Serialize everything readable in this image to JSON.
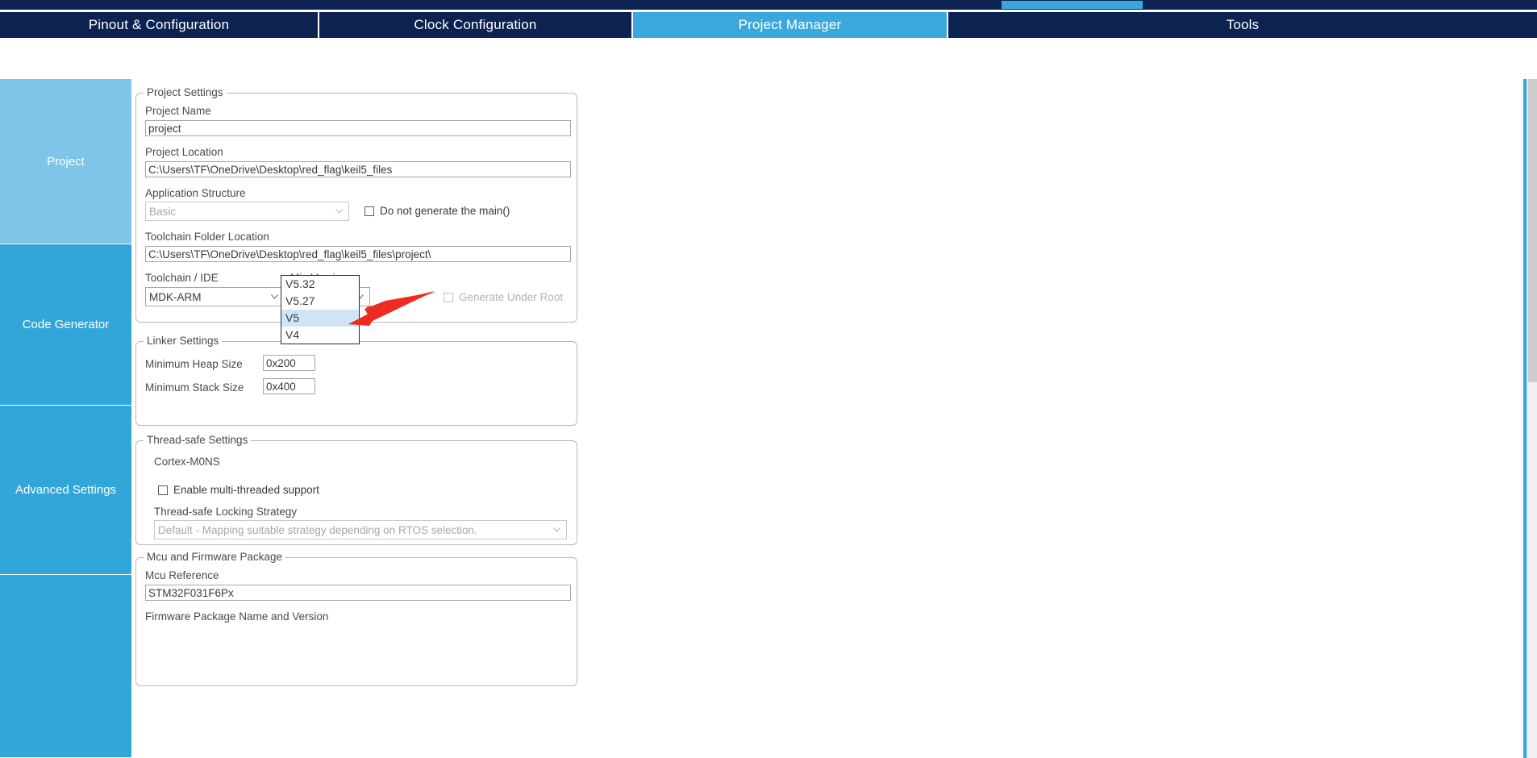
{
  "app": {
    "accent_blue": "#3aa8dc",
    "navy": "#0c2251",
    "sidebar_blue": "#32a6d9",
    "sidebar_selected_blue": "#7ec5e8",
    "annotation_red": "#ee2b20"
  },
  "tabs": [
    {
      "label": "Pinout & Configuration",
      "active": false
    },
    {
      "label": "Clock Configuration",
      "active": false
    },
    {
      "label": "Project Manager",
      "active": true
    },
    {
      "label": "Tools",
      "active": false
    }
  ],
  "sidebar": {
    "items": [
      {
        "label": "Project",
        "selected": true
      },
      {
        "label": "Code Generator",
        "selected": false
      },
      {
        "label": "Advanced Settings",
        "selected": false
      },
      {
        "label": "",
        "selected": false
      }
    ]
  },
  "project_settings": {
    "legend": "Project Settings",
    "project_name_label": "Project Name",
    "project_name_value": "project",
    "project_location_label": "Project Location",
    "project_location_value": "C:\\Users\\TF\\OneDrive\\Desktop\\red_flag\\keil5_files",
    "application_structure_label": "Application Structure",
    "application_structure_value": "Basic",
    "do_not_generate_main_label": "Do not generate the main()",
    "do_not_generate_main_checked": false,
    "toolchain_folder_label": "Toolchain Folder Location",
    "toolchain_folder_value": "C:\\Users\\TF\\OneDrive\\Desktop\\red_flag\\keil5_files\\project\\",
    "toolchain_ide_label": "Toolchain / IDE",
    "toolchain_ide_value": "MDK-ARM",
    "min_version_label": "Min Version",
    "min_version_value": "V5",
    "generate_under_root_label": "Generate Under Root",
    "generate_under_root_checked": true,
    "generate_under_root_disabled": true
  },
  "min_version_dropdown": {
    "open": true,
    "options": [
      {
        "label": "V5.32",
        "highlighted": false
      },
      {
        "label": "V5.27",
        "highlighted": false
      },
      {
        "label": "V5",
        "highlighted": true
      },
      {
        "label": "V4",
        "highlighted": false
      }
    ]
  },
  "linker_settings": {
    "legend": "Linker Settings",
    "min_heap_label": "Minimum Heap Size",
    "min_heap_value": "0x200",
    "min_stack_label": "Minimum Stack Size",
    "min_stack_value": "0x400"
  },
  "thread_safe_settings": {
    "legend": "Thread-safe Settings",
    "core_label": "Cortex-M0NS",
    "enable_multithread_label": "Enable multi-threaded support",
    "enable_multithread_checked": false,
    "locking_strategy_label": "Thread-safe Locking Strategy",
    "locking_strategy_value": "Default  -  Mapping suitable strategy depending on RTOS selection."
  },
  "mcu_firmware_package": {
    "legend": "Mcu and Firmware Package",
    "mcu_reference_label": "Mcu Reference",
    "mcu_reference_value": "STM32F031F6Px",
    "firmware_package_label": "Firmware Package Name and Version"
  },
  "icons": {
    "chevron_down": "chevron-down-icon",
    "arrow_pointer": "red-arrow-annotation"
  }
}
